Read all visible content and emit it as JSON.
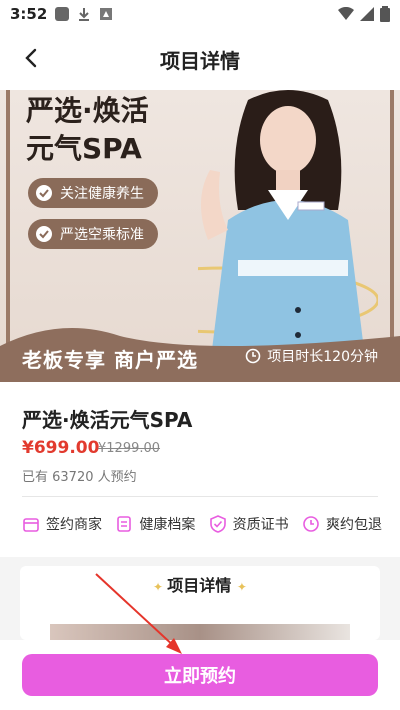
{
  "status_bar": {
    "time": "3:52"
  },
  "nav": {
    "title": "项目详情"
  },
  "banner": {
    "headline_line1": "严选·焕活",
    "headline_line2": "元气SPA",
    "pills": [
      "关注健康养生",
      "严选空乘标准"
    ],
    "band_label": "老板专享  商户严选",
    "duration": "项目时长120分钟"
  },
  "product": {
    "name": "严选·焕活元气SPA",
    "price": "¥699.00",
    "original_price": "¥1299.00",
    "booked": "已有 63720 人预约"
  },
  "features": [
    "签约商家",
    "健康档案",
    "资质证书",
    "爽约包退"
  ],
  "details": {
    "heading": "项目详情"
  },
  "footer": {
    "book_label": "立即预约"
  },
  "colors": {
    "accent": "#e85de0",
    "price": "#e23a2e",
    "banner_brown": "#8a6b59"
  }
}
